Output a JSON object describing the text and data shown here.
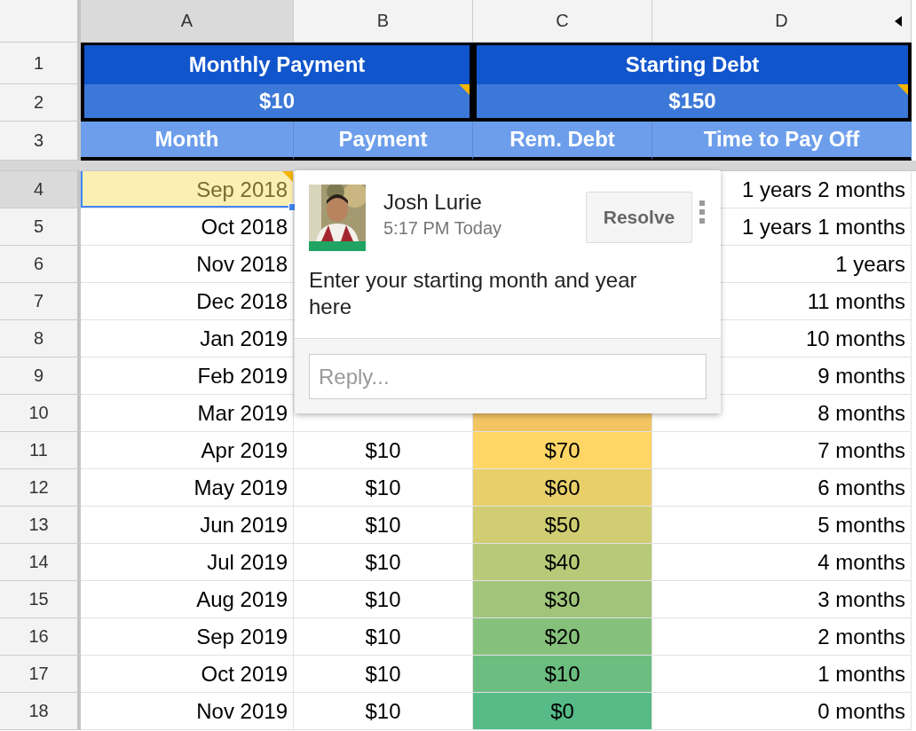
{
  "columns": [
    {
      "label": "A",
      "selected": true
    },
    {
      "label": "B",
      "selected": false
    },
    {
      "label": "C",
      "selected": false
    },
    {
      "label": "D",
      "selected": false
    }
  ],
  "summary": {
    "rows": [
      "1",
      "2"
    ],
    "blocks": [
      {
        "title": "Monthly Payment",
        "value": "$10",
        "commented": true
      },
      {
        "title": "Starting Debt",
        "value": "$150",
        "commented": true
      }
    ]
  },
  "table": {
    "header_row": "3",
    "columns": [
      "Month",
      "Payment",
      "Rem. Debt",
      "Time to Pay Off"
    ],
    "rows": [
      {
        "row": "4",
        "selected": true,
        "commented": true,
        "month": "Sep 2018",
        "time": "1 years 2 months"
      },
      {
        "row": "5",
        "selected": false,
        "commented": false,
        "month": "Oct 2018",
        "time": "1 years 1 months"
      },
      {
        "row": "6",
        "selected": false,
        "commented": false,
        "month": "Nov 2018",
        "time": "1 years"
      },
      {
        "row": "7",
        "selected": false,
        "commented": false,
        "month": "Dec 2018",
        "time": "11 months"
      },
      {
        "row": "8",
        "selected": false,
        "commented": false,
        "month": "Jan 2019",
        "time": "10 months"
      },
      {
        "row": "9",
        "selected": false,
        "commented": false,
        "month": "Feb 2019",
        "time": "9 months"
      },
      {
        "row": "10",
        "selected": false,
        "commented": false,
        "month": "Mar 2019",
        "color": "#f2c462",
        "time": "8 months"
      },
      {
        "row": "11",
        "selected": false,
        "commented": false,
        "month": "Apr 2019",
        "payment": "$10",
        "debt": "$70",
        "color": "#ffd666",
        "time": "7 months"
      },
      {
        "row": "12",
        "selected": false,
        "commented": false,
        "month": "May 2019",
        "payment": "$10",
        "debt": "$60",
        "color": "#e8cf6a",
        "time": "6 months"
      },
      {
        "row": "13",
        "selected": false,
        "commented": false,
        "month": "Jun 2019",
        "payment": "$10",
        "debt": "$50",
        "color": "#d0cd72",
        "time": "5 months"
      },
      {
        "row": "14",
        "selected": false,
        "commented": false,
        "month": "Jul 2019",
        "payment": "$10",
        "debt": "$40",
        "color": "#b8c978",
        "time": "4 months"
      },
      {
        "row": "15",
        "selected": false,
        "commented": false,
        "month": "Aug 2019",
        "payment": "$10",
        "debt": "$30",
        "color": "#a0c57a",
        "time": "3 months"
      },
      {
        "row": "16",
        "selected": false,
        "commented": false,
        "month": "Sep 2019",
        "payment": "$10",
        "debt": "$20",
        "color": "#86c17c",
        "time": "2 months"
      },
      {
        "row": "17",
        "selected": false,
        "commented": false,
        "month": "Oct 2019",
        "payment": "$10",
        "debt": "$10",
        "color": "#6cbd80",
        "time": "1 months"
      },
      {
        "row": "18",
        "selected": false,
        "commented": false,
        "month": "Nov 2019",
        "payment": "$10",
        "debt": "$0",
        "color": "#56bb87",
        "time": "0 months"
      }
    ]
  },
  "comment": {
    "author": "Josh Lurie",
    "time": "5:17 PM Today",
    "resolve": "Resolve",
    "text": "Enter your starting month and year here",
    "reply": {
      "placeholder": "Reply..."
    }
  }
}
